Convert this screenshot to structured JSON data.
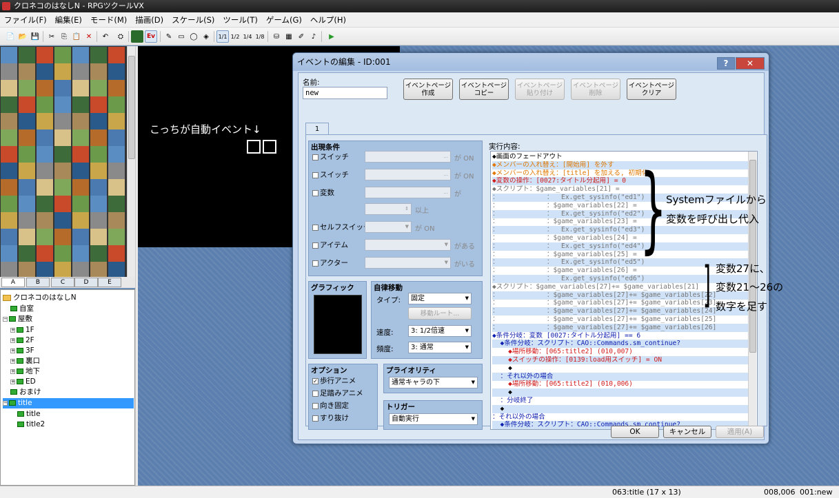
{
  "window": {
    "title": "クロネコのはなしN - RPGツクールVX"
  },
  "menu": [
    "ファイル(F)",
    "編集(E)",
    "モード(M)",
    "描画(D)",
    "スケール(S)",
    "ツール(T)",
    "ゲーム(G)",
    "ヘルプ(H)"
  ],
  "toolbar": {
    "scale_labels": [
      "1/1",
      "1/2",
      "1/4",
      "1/8"
    ]
  },
  "tileset_tabs": [
    "A",
    "B",
    "C",
    "D",
    "E"
  ],
  "map_tree": [
    {
      "label": "クロネコのはなしN",
      "type": "root"
    },
    {
      "label": "自室",
      "type": "map"
    },
    {
      "label": "屋敷",
      "type": "map"
    },
    {
      "label": "1F",
      "type": "map"
    },
    {
      "label": "2F",
      "type": "map"
    },
    {
      "label": "3F",
      "type": "map"
    },
    {
      "label": "裏口",
      "type": "map"
    },
    {
      "label": "地下",
      "type": "map"
    },
    {
      "label": "ED",
      "type": "map"
    },
    {
      "label": "おまけ",
      "type": "map"
    },
    {
      "label": "title",
      "type": "map",
      "selected": true
    },
    {
      "label": "title",
      "type": "map"
    },
    {
      "label": "title2",
      "type": "map"
    }
  ],
  "map_overlay_text": "こっちが自動イベント↓",
  "status": {
    "map": "063:title (17 x 13)",
    "coords": "008,006",
    "event": "001:new"
  },
  "dialog": {
    "title": "イベントの編集 - ID:001",
    "name_label": "名前:",
    "name_value": "new",
    "page_buttons": [
      {
        "label": "イベントページ\n作成",
        "enabled": true
      },
      {
        "label": "イベントページ\nコピー",
        "enabled": true
      },
      {
        "label": "イベントページ\n貼り付け",
        "enabled": false
      },
      {
        "label": "イベントページ\n削除",
        "enabled": false
      },
      {
        "label": "イベントページ\nクリア",
        "enabled": true
      }
    ],
    "page_tab": "1",
    "conditions": {
      "title": "出現条件",
      "switch1": "スイッチ",
      "switch2": "スイッチ",
      "variable": "変数",
      "self_switch": "セルフスイッチ",
      "item": "アイテム",
      "actor": "アクター",
      "ga_on": "が ON",
      "ga": "が",
      "ijou": "以上",
      "ga_aru": "がある",
      "ga_iru": "がいる",
      "dots": "..."
    },
    "graphic": {
      "title": "グラフィック"
    },
    "movement": {
      "title": "自律移動",
      "type_label": "タイプ:",
      "type_value": "固定",
      "route_button": "移動ルート...",
      "speed_label": "速度:",
      "speed_value": "3: 1/2倍速",
      "freq_label": "頻度:",
      "freq_value": "3: 通常"
    },
    "options": {
      "title": "オプション",
      "items": [
        {
          "label": "歩行アニメ",
          "checked": true
        },
        {
          "label": "足踏みアニメ",
          "checked": false
        },
        {
          "label": "向き固定",
          "checked": false
        },
        {
          "label": "すり抜け",
          "checked": false
        }
      ]
    },
    "priority": {
      "title": "プライオリティ",
      "value": "通常キャラの下"
    },
    "trigger": {
      "title": "トリガー",
      "value": "自動実行"
    },
    "contents_label": "実行内容:",
    "contents": [
      {
        "text": "◆画面のフェードアウト",
        "color": "black"
      },
      {
        "text": "◆メンバーの入れ替え：[開始用] を外す",
        "color": "orange"
      },
      {
        "text": "◆メンバーの入れ替え：[title] を加える, 初期化",
        "color": "orange"
      },
      {
        "text": "◆変数の操作：[0027:タイトル分起用] = 0",
        "color": "red"
      },
      {
        "text": "◆スクリプト：$game_variables[21] =",
        "color": "gray"
      },
      {
        "text": "：            ：  Ex.get_sysinfo(\"ed1\")",
        "color": "gray"
      },
      {
        "text": "：            ：$game_variables[22] =",
        "color": "gray"
      },
      {
        "text": "：            ：  Ex.get_sysinfo(\"ed2\")",
        "color": "gray"
      },
      {
        "text": "：            ：$game_variables[23] =",
        "color": "gray"
      },
      {
        "text": "：            ：  Ex.get_sysinfo(\"ed3\")",
        "color": "gray"
      },
      {
        "text": "：            ：$game_variables[24] =",
        "color": "gray"
      },
      {
        "text": "：            ：  Ex.get_sysinfo(\"ed4\")",
        "color": "gray"
      },
      {
        "text": "：            ：$game_variables[25] =",
        "color": "gray"
      },
      {
        "text": "：            ：  Ex.get_sysinfo(\"ed5\")",
        "color": "gray"
      },
      {
        "text": "：            ：$game_variables[26] =",
        "color": "gray"
      },
      {
        "text": "：            ：  Ex.get_sysinfo(\"ed6\")",
        "color": "gray"
      },
      {
        "text": "◆スクリプト：$game_variables[27]+= $game_variables[21]",
        "color": "gray"
      },
      {
        "text": "：            ：$game_variables[27]+= $game_variables[22]",
        "color": "gray"
      },
      {
        "text": "：            ：$game_variables[27]+= $game_variables[23]",
        "color": "gray"
      },
      {
        "text": "：            ：$game_variables[27]+= $game_variables[24]",
        "color": "gray"
      },
      {
        "text": "：            ：$game_variables[27]+= $game_variables[25]",
        "color": "gray"
      },
      {
        "text": "：            ：$game_variables[27]+= $game_variables[26]",
        "color": "gray"
      },
      {
        "text": "◆条件分岐：変数 [0027:タイトル分起用] == 6",
        "color": "blue"
      },
      {
        "text": "  ◆条件分岐：スクリプト：CAO::Commands.sm_continue?",
        "color": "blue"
      },
      {
        "text": "    ◆場所移動：[065:title2] (010,007)",
        "color": "red"
      },
      {
        "text": "    ◆スイッチの操作：[0139:load用スイッチ] = ON",
        "color": "red"
      },
      {
        "text": "    ◆",
        "color": "black"
      },
      {
        "text": "  ：それ以外の場合",
        "color": "blue"
      },
      {
        "text": "    ◆場所移動：[065:title2] (010,006)",
        "color": "red"
      },
      {
        "text": "    ◆",
        "color": "black"
      },
      {
        "text": "  ：分岐終了",
        "color": "blue"
      },
      {
        "text": "  ◆",
        "color": "black"
      },
      {
        "text": "：それ以外の場合",
        "color": "blue"
      },
      {
        "text": "  ◆条件分岐：スクリプト：CAO::Commands.sm_continue?",
        "color": "blue"
      }
    ],
    "buttons": {
      "ok": "OK",
      "cancel": "キャンセル",
      "apply": "適用(A)"
    }
  },
  "annotations": {
    "a1_line1": "Systemファイルから",
    "a1_line2": "変数を呼び出し代入",
    "a2_line1": "変数27に、",
    "a2_line2": "変数21～26の",
    "a2_line3": "数字を足す"
  },
  "colors": {
    "black": "#000000",
    "red": "#d21c1c",
    "orange": "#e07800",
    "blue": "#1020b0",
    "gray": "#777777"
  }
}
